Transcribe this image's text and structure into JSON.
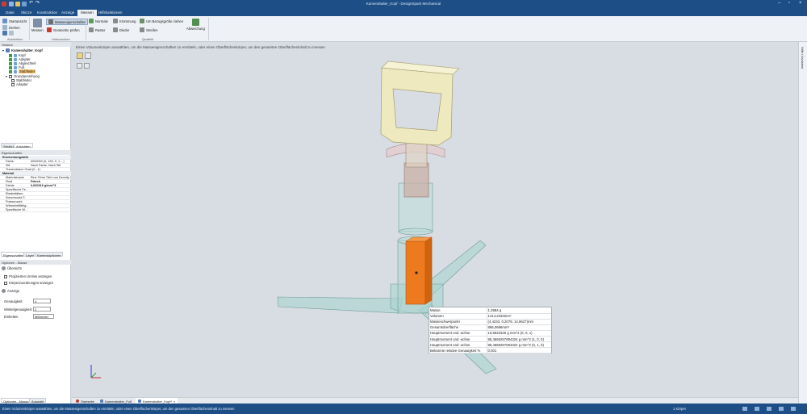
{
  "window": {
    "title": "Kamerahalter_Kopf - DesignSpark Mechanical"
  },
  "tabs": [
    "Datei",
    "Skizze",
    "Konstruktion",
    "Anzeige",
    "Messen",
    "Hilfsfunktionen"
  ],
  "ribbon": {
    "ausrichten": {
      "items": [
        "Startansicht",
        "Drehen"
      ],
      "group": "Ausrichten"
    },
    "untersuchen": {
      "measure": "Messen",
      "mass_props": "Masseeigenschaften",
      "check_geometry": "Geometrie prüfen",
      "group": "Untersuchen"
    },
    "qualitaet": {
      "normale": "Normale",
      "kruemmung": "Krümmung",
      "rasterung": "Raster",
      "dieder": "Dieder",
      "bezugsgroessen": "Um Bezugsgröße ziehen",
      "streifen": "Streifen",
      "abweichung": "Abweichung",
      "group": "Qualität"
    }
  },
  "structure": {
    "header": "Struktur",
    "root": "Kamerahalter_Kopf",
    "items": [
      "Kopf",
      "Adapter",
      "Abgleichteil",
      "Fuß",
      "Stabfinder",
      "Grundanordnung",
      "Stabfinder",
      "Adapter"
    ],
    "tabs": [
      "Struktur",
      "Ansichten"
    ]
  },
  "properties": {
    "header": "Eigenschaften",
    "sections": [
      {
        "title": "Erscheinungsbild",
        "rows": [
          [
            "Farbe",
            "#000000 (0, 133, 0, 1 ...)"
          ],
          [
            "Stil",
            "Nach Farbe, Nach Stil"
          ],
          [
            "Transmission Grad (0...1)",
            ""
          ]
        ]
      },
      {
        "title": "Material",
        "rows": [
          [
            "Materialname",
            "Eine Ohne Titel Low Density"
          ],
          [
            "Fluid",
            "Falsch"
          ],
          [
            "Dichte",
            "0,000916 g/mm^3"
          ],
          [
            "Spezifische Fe..",
            ""
          ],
          [
            "Elastizitätsm..",
            ""
          ],
          [
            "Schermodul F..",
            ""
          ],
          [
            "Poissonzahl",
            ""
          ],
          [
            "Wärmeleitfähig..",
            ""
          ],
          [
            "Spezifische W..",
            ""
          ]
        ]
      }
    ],
    "tabs": [
      "Eigenschaften",
      "Layer",
      "Kameraoptionen"
    ]
  },
  "options": {
    "header": "Optionen - Masse",
    "section1": "Übersicht",
    "opt1": "Projizierten Umriss anzeigen",
    "opt2": "Körperzuordnungen anzeigen",
    "section2": "Anzeige",
    "genauigkeit_label": "Genauigkeit:",
    "genauigkeit": "4",
    "winkel_label": "Winkelgenauigkeit:",
    "winkel": "2",
    "einheiten_label": "Einheiten",
    "einheiten": "Millimeter",
    "tabs": [
      "Optionen - Masse",
      "Auswahl"
    ]
  },
  "viewport": {
    "hint": "Einen Volumenkörper auswählen, um die Masseeigenschaften zu ermitteln, oder einen Oberflächenkörper, um den gesamten Oberflächeninhalt zu messen"
  },
  "mass_properties": [
    [
      "Masse",
      "1,2984 g"
    ],
    [
      "Volumen",
      "1414,2333mm³"
    ],
    [
      "Masseschwerpunkt",
      "(4,4233, 0,2078, 14,8627)mm"
    ],
    [
      "Gesamtoberfläche",
      "896,0686mm²"
    ],
    [
      "Hauptmoment und -achse",
      "10,5922326 g mm^2 (0, 0, 1)"
    ],
    [
      "Hauptmoment und -achse",
      "95,4666257694324 g mm^2 (1, 0, 0)"
    ],
    [
      "Hauptmoment und -achse",
      "95,4666257694324 g mm^2 (0, 1, 0)"
    ],
    [
      "Bekannte relative Genauigkeit %",
      "0,001"
    ]
  ],
  "doc_tabs": [
    "Startseite",
    "Kamerahalter_Fuß",
    "Kamerahalter_Kopf*"
  ],
  "status": {
    "message": "Einen Volumenkörper auswählen, um die Masseeigenschaften zu ermitteln, oder einen Oberflächenkörper, um den gesamten Oberflächeninhalt zu messen",
    "selection": "1 Körper"
  },
  "side_panel": "Hilfe / Assistent",
  "colors": {
    "accent": "#1e4e86",
    "selected_body": "#ee7a1f",
    "glass": "#a8d3cf",
    "handle": "#efe9c0"
  }
}
